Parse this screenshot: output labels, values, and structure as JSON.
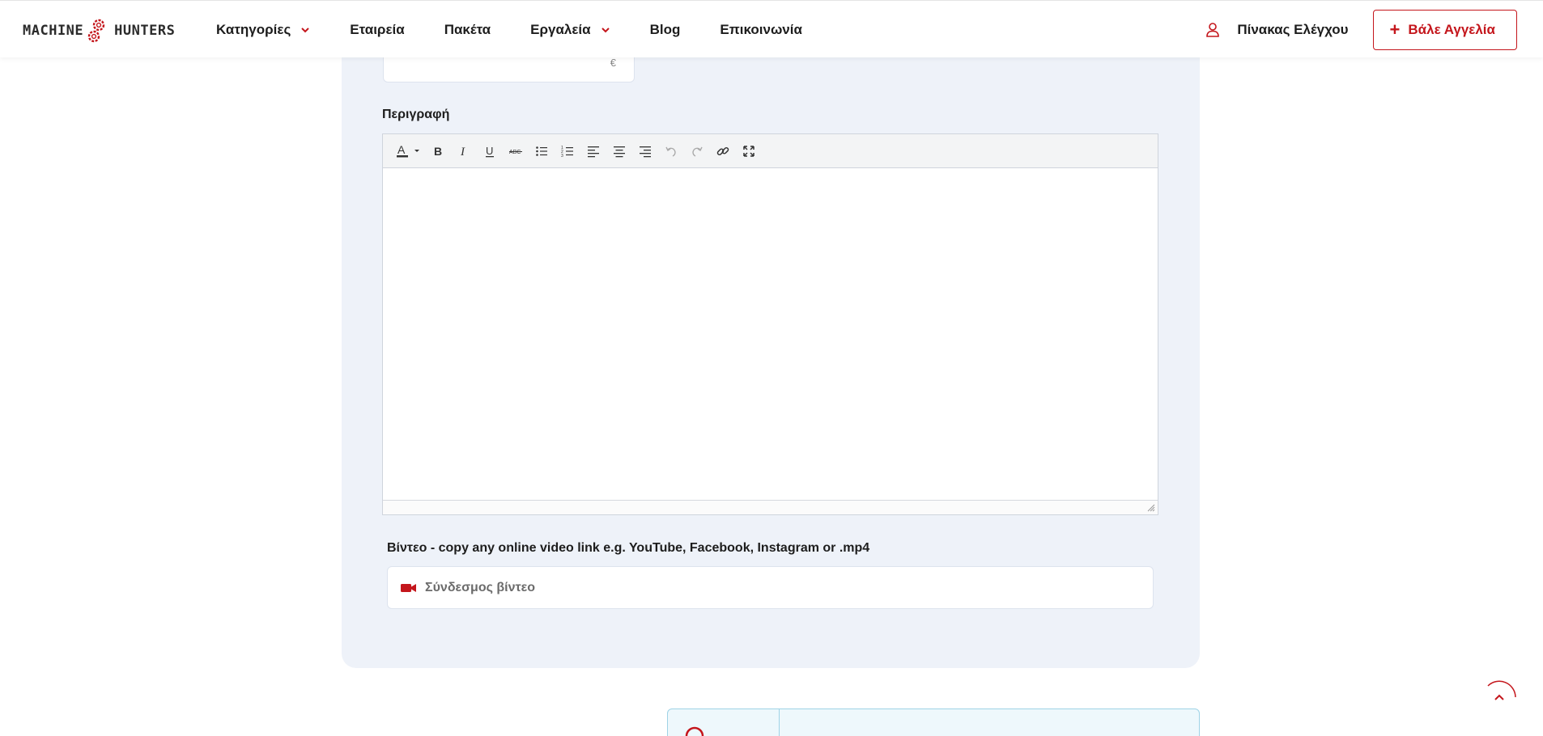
{
  "header": {
    "logo": {
      "left_text": "MACHINE",
      "right_text": "HUNTERS"
    },
    "nav": [
      {
        "label": "Κατηγορίες",
        "has_dropdown": true
      },
      {
        "label": "Εταιρεία",
        "has_dropdown": false
      },
      {
        "label": "Πακέτα",
        "has_dropdown": false
      },
      {
        "label": "Εργαλεία",
        "has_dropdown": true
      },
      {
        "label": "Blog",
        "has_dropdown": false
      },
      {
        "label": "Επικοινωνία",
        "has_dropdown": false
      }
    ],
    "dashboard_label": "Πίνακας Ελέγχου",
    "post_ad_label": "Βάλε Αγγελία",
    "post_ad_icon": "+"
  },
  "form": {
    "price": {
      "value": "",
      "currency": "€"
    },
    "description": {
      "label": "Περιγραφή",
      "value": "",
      "toolbar": [
        "text-color",
        "bold",
        "italic",
        "underline",
        "strikethrough",
        "bulleted-list",
        "numbered-list",
        "align-left",
        "align-center",
        "align-right",
        "undo",
        "redo",
        "link",
        "fullscreen"
      ]
    },
    "video": {
      "label": "Βίντεο - copy any online video link e.g. YouTube, Facebook, Instagram or .mp4",
      "placeholder": "Σύνδεσμος βίντεο",
      "value": ""
    }
  },
  "colors": {
    "accent": "#c4161c",
    "panel_bg": "#eef2f9",
    "info_border": "#9fd3e6"
  }
}
